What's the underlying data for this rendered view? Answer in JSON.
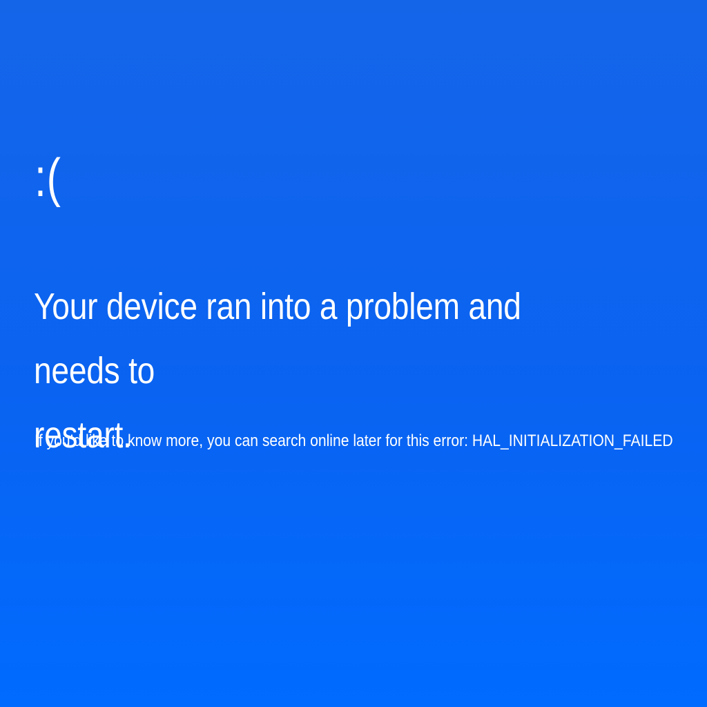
{
  "screen": {
    "background_color": "#0a63f1",
    "text_color": "#ffffff",
    "sad_face": ":(",
    "message_line1": "Your device ran into a problem and needs to",
    "message_line2": "restart.",
    "info_prefix": "If you’d like to know more, you can search online later for this error: ",
    "error_code": "HAL_INITIALIZATION_FAILED"
  }
}
